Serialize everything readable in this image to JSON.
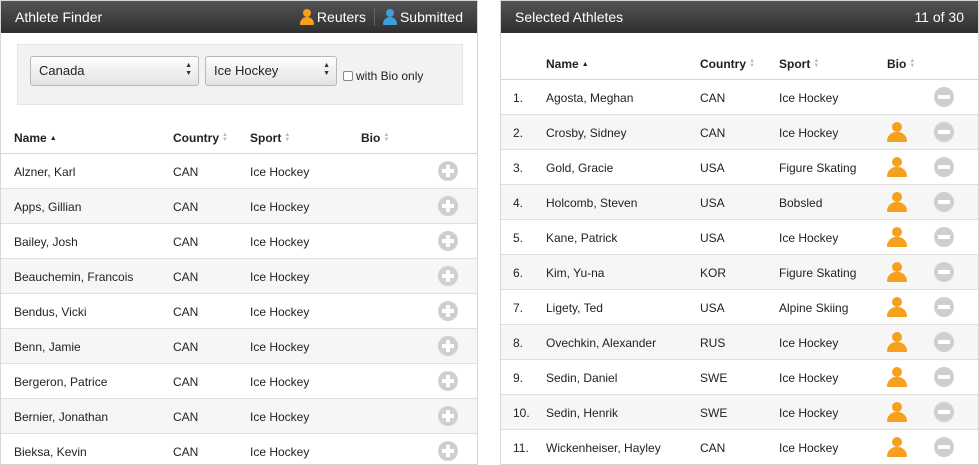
{
  "finder": {
    "title": "Athlete Finder",
    "legend": {
      "reuters": "Reuters",
      "submitted": "Submitted"
    },
    "filters": {
      "country": "Canada",
      "sport": "Ice Hockey",
      "bio_only_label": "with Bio only",
      "bio_only_checked": false
    },
    "columns": {
      "name": "Name",
      "country": "Country",
      "sport": "Sport",
      "bio": "Bio"
    },
    "rows": [
      {
        "name": "Alzner, Karl",
        "country": "CAN",
        "sport": "Ice Hockey"
      },
      {
        "name": "Apps, Gillian",
        "country": "CAN",
        "sport": "Ice Hockey"
      },
      {
        "name": "Bailey, Josh",
        "country": "CAN",
        "sport": "Ice Hockey"
      },
      {
        "name": "Beauchemin, Francois",
        "country": "CAN",
        "sport": "Ice Hockey"
      },
      {
        "name": "Bendus, Vicki",
        "country": "CAN",
        "sport": "Ice Hockey"
      },
      {
        "name": "Benn, Jamie",
        "country": "CAN",
        "sport": "Ice Hockey"
      },
      {
        "name": "Bergeron, Patrice",
        "country": "CAN",
        "sport": "Ice Hockey"
      },
      {
        "name": "Bernier, Jonathan",
        "country": "CAN",
        "sport": "Ice Hockey"
      },
      {
        "name": "Bieksa, Kevin",
        "country": "CAN",
        "sport": "Ice Hockey"
      }
    ]
  },
  "selected": {
    "title": "Selected Athletes",
    "count": "11 of 30",
    "columns": {
      "name": "Name",
      "country": "Country",
      "sport": "Sport",
      "bio": "Bio"
    },
    "rows": [
      {
        "num": "1.",
        "name": "Agosta, Meghan",
        "country": "CAN",
        "sport": "Ice Hockey",
        "bio": false
      },
      {
        "num": "2.",
        "name": "Crosby, Sidney",
        "country": "CAN",
        "sport": "Ice Hockey",
        "bio": true
      },
      {
        "num": "3.",
        "name": "Gold, Gracie",
        "country": "USA",
        "sport": "Figure Skating",
        "bio": true
      },
      {
        "num": "4.",
        "name": "Holcomb, Steven",
        "country": "USA",
        "sport": "Bobsled",
        "bio": true
      },
      {
        "num": "5.",
        "name": "Kane, Patrick",
        "country": "USA",
        "sport": "Ice Hockey",
        "bio": true
      },
      {
        "num": "6.",
        "name": "Kim, Yu-na",
        "country": "KOR",
        "sport": "Figure Skating",
        "bio": true
      },
      {
        "num": "7.",
        "name": "Ligety, Ted",
        "country": "USA",
        "sport": "Alpine Skiing",
        "bio": true
      },
      {
        "num": "8.",
        "name": "Ovechkin, Alexander",
        "country": "RUS",
        "sport": "Ice Hockey",
        "bio": true
      },
      {
        "num": "9.",
        "name": "Sedin, Daniel",
        "country": "SWE",
        "sport": "Ice Hockey",
        "bio": true
      },
      {
        "num": "10.",
        "name": "Sedin, Henrik",
        "country": "SWE",
        "sport": "Ice Hockey",
        "bio": true
      },
      {
        "num": "11.",
        "name": "Wickenheiser, Hayley",
        "country": "CAN",
        "sport": "Ice Hockey",
        "bio": true
      }
    ]
  },
  "colors": {
    "reuters": "#f7a01d",
    "submitted": "#3f9fd8",
    "titlebar": "#3a3a3a"
  }
}
